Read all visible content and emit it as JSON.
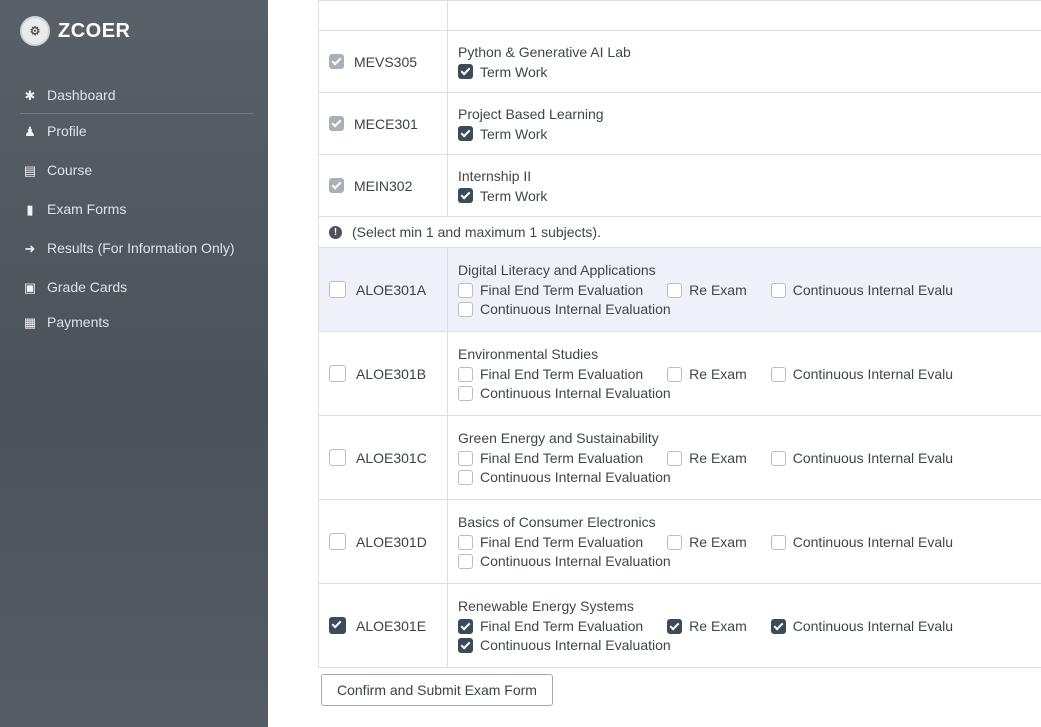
{
  "brand": {
    "name": "ZCOER"
  },
  "sidebar": {
    "items": [
      {
        "label": "Dashboard",
        "icon": "dashboard-icon"
      },
      {
        "label": "Profile",
        "icon": "user-icon"
      },
      {
        "label": "Course",
        "icon": "book-icon"
      },
      {
        "label": "Exam Forms",
        "icon": "document-icon"
      },
      {
        "label": "Results (For Information Only)",
        "icon": "arrow-right-icon"
      },
      {
        "label": "Grade Cards",
        "icon": "card-icon"
      },
      {
        "label": "Payments",
        "icon": "payment-icon"
      }
    ]
  },
  "mandatory_subjects": [
    {
      "code": "MEVS305",
      "name": "Python & Generative AI Lab",
      "component": "Term Work"
    },
    {
      "code": "MECE301",
      "name": "Project Based Learning",
      "component": "Term Work"
    },
    {
      "code": "MEIN302",
      "name": "Internship II",
      "component": "Term Work"
    }
  ],
  "elective_note": "(Select min 1 and maximum 1 subjects).",
  "electives": [
    {
      "code": "ALOE301A",
      "name": "Digital Literacy and Applications",
      "selected": false,
      "options": [
        "Final End Term Evaluation",
        "Re Exam",
        "Continuous Internal Evalu",
        "Continuous Internal Evaluation"
      ]
    },
    {
      "code": "ALOE301B",
      "name": "Environmental Studies",
      "selected": false,
      "options": [
        "Final End Term Evaluation",
        "Re Exam",
        "Continuous Internal Evalu",
        "Continuous Internal Evaluation"
      ]
    },
    {
      "code": "ALOE301C",
      "name": "Green Energy and Sustainability",
      "selected": false,
      "options": [
        "Final End Term Evaluation",
        "Re Exam",
        "Continuous Internal Evalu",
        "Continuous Internal Evaluation"
      ]
    },
    {
      "code": "ALOE301D",
      "name": "Basics of Consumer Electronics",
      "selected": false,
      "options": [
        "Final End Term Evaluation",
        "Re Exam",
        "Continuous Internal Evalu",
        "Continuous Internal Evaluation"
      ]
    },
    {
      "code": "ALOE301E",
      "name": "Renewable Energy Systems",
      "selected": true,
      "options": [
        "Final End Term Evaluation",
        "Re Exam",
        "Continuous Internal Evalu",
        "Continuous Internal Evaluation"
      ]
    }
  ],
  "submit_label": "Confirm and Submit Exam Form"
}
